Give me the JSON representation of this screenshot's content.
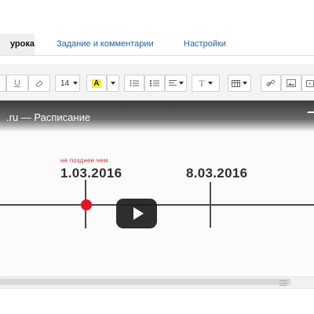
{
  "tabs": {
    "active": "урока",
    "task": "Задание и комментарии",
    "settings": "Настройки"
  },
  "toolbar": {
    "underline": "U",
    "font_size": "14",
    "font_color_letter": "A",
    "font_color_accent": "#f7ef1a",
    "text_type": "T"
  },
  "video": {
    "title": ".ru — Расписание",
    "small_note": "не позднее чем",
    "date_left": "1.03.2016",
    "date_right": "8.03.2016",
    "accent": "#e5141e"
  }
}
